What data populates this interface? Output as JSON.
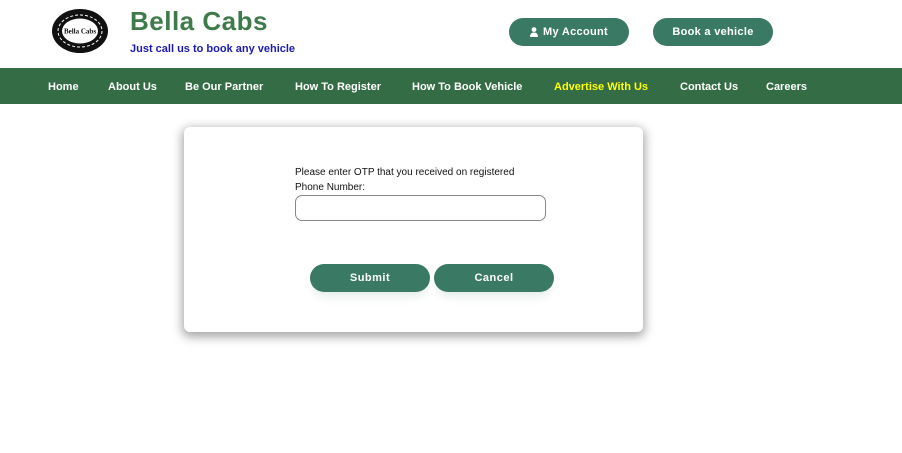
{
  "header": {
    "logo_text": "Bella Cabs",
    "brand": "Bella Cabs",
    "tagline": "Just call us to book any vehicle",
    "my_account": "My Account",
    "book_vehicle": "Book a vehicle"
  },
  "nav": {
    "items": [
      {
        "label": "Home"
      },
      {
        "label": "About Us"
      },
      {
        "label": "Be Our Partner"
      },
      {
        "label": "How To Register"
      },
      {
        "label": "How To Book Vehicle"
      },
      {
        "label": "Advertise With Us"
      },
      {
        "label": "Contact Us"
      },
      {
        "label": "Careers"
      }
    ],
    "highlight_color": "#ffff00"
  },
  "otp_dialog": {
    "prompt": "Please enter OTP that you received on registered Phone Number:",
    "otp_value": "",
    "submit": "Submit",
    "cancel": "Cancel"
  },
  "colors": {
    "brand": "#3f7a4a",
    "nav_bg": "#336c45",
    "button": "#3a7a64",
    "tagline": "#1b1bb3"
  }
}
